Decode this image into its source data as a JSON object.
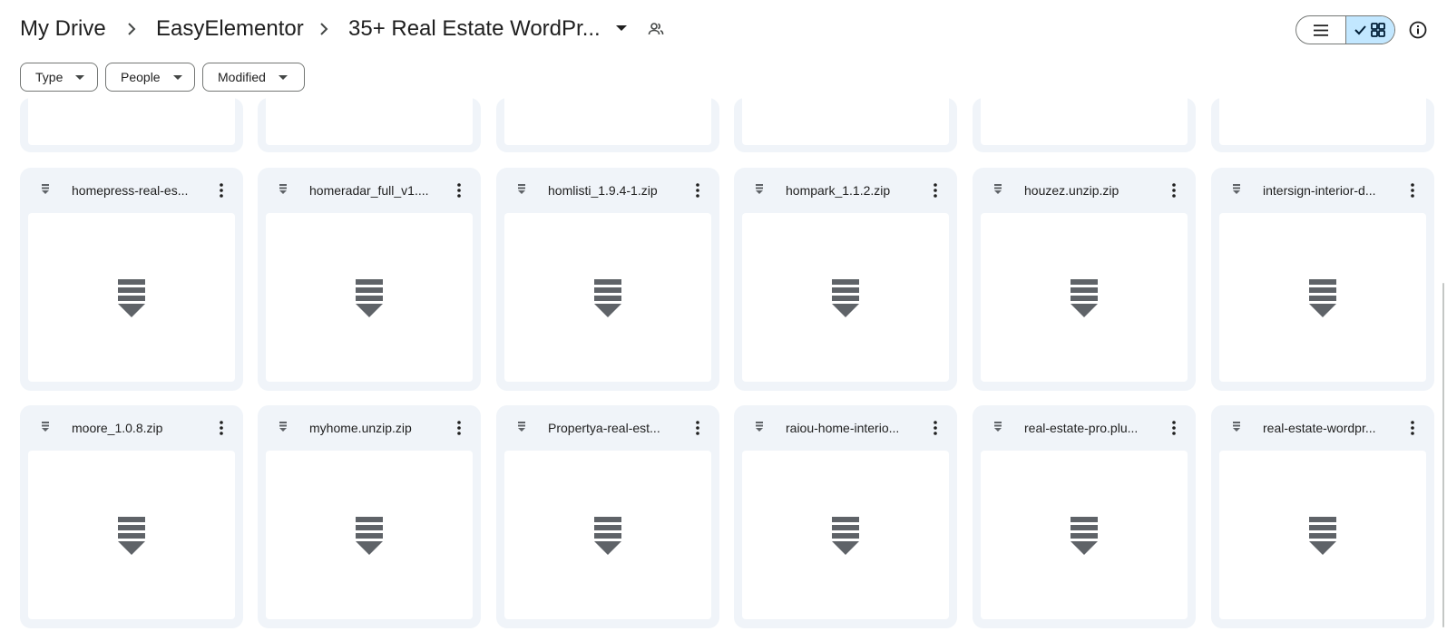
{
  "breadcrumb": {
    "items": [
      "My Drive",
      "EasyElementor",
      "35+ Real Estate WordPr..."
    ]
  },
  "filters": {
    "type_label": "Type",
    "people_label": "People",
    "modified_label": "Modified"
  },
  "colors": {
    "selected_view": "#c2e7ff",
    "card_bg": "#f0f4f9",
    "zip_icon": "#5f6368"
  },
  "files": [
    {
      "name": "homepress-real-es...",
      "icon": "zip-icon"
    },
    {
      "name": "homeradar_full_v1....",
      "icon": "zip-icon"
    },
    {
      "name": "homlisti_1.9.4-1.zip",
      "icon": "zip-icon"
    },
    {
      "name": "hompark_1.1.2.zip",
      "icon": "zip-icon"
    },
    {
      "name": "houzez.unzip.zip",
      "icon": "zip-icon"
    },
    {
      "name": "intersign-interior-d...",
      "icon": "zip-icon"
    },
    {
      "name": "moore_1.0.8.zip",
      "icon": "zip-icon"
    },
    {
      "name": "myhome.unzip.zip",
      "icon": "zip-icon"
    },
    {
      "name": "Propertya-real-est...",
      "icon": "zip-icon"
    },
    {
      "name": "raiou-home-interio...",
      "icon": "zip-icon"
    },
    {
      "name": "real-estate-pro.plu...",
      "icon": "zip-icon"
    },
    {
      "name": "real-estate-wordpr...",
      "icon": "zip-icon"
    }
  ]
}
